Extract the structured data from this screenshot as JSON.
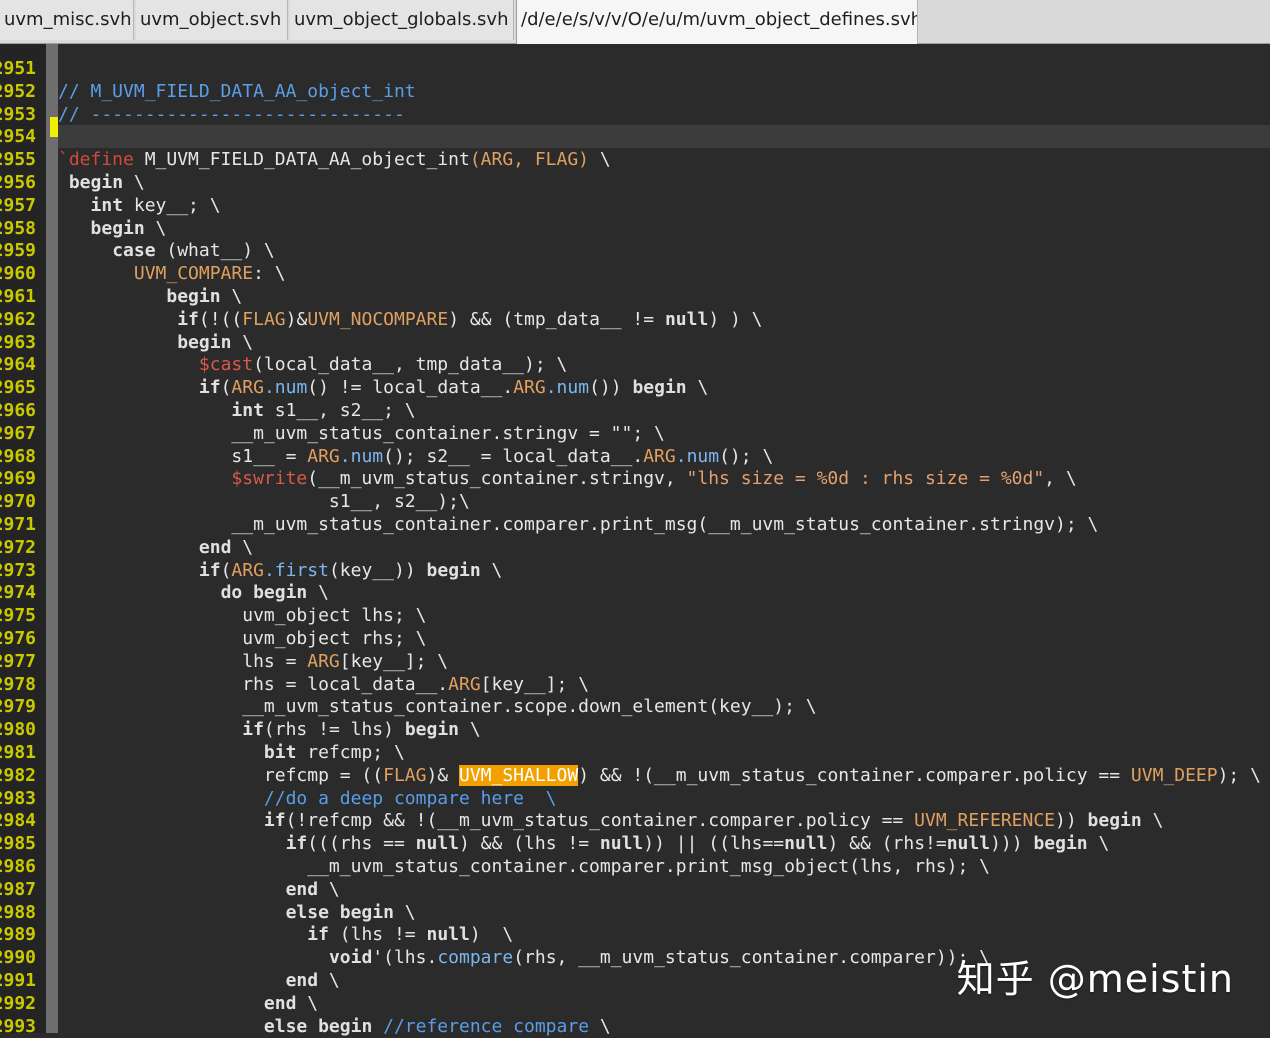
{
  "tabs": [
    {
      "label": "uvm_misc.svh",
      "active": false
    },
    {
      "label": "uvm_object.svh",
      "active": false
    },
    {
      "label": "uvm_object_globals.svh",
      "active": false
    },
    {
      "label": "/d/e/e/s/v/v/O/e/u/m/uvm_object_defines.svh",
      "active": true
    }
  ],
  "current_line": 2954,
  "lines": [
    {
      "n": "2951",
      "tokens": []
    },
    {
      "n": "2952",
      "tokens": [
        [
          "cm",
          "// M_UVM_FIELD_DATA_AA_object_int"
        ]
      ]
    },
    {
      "n": "2953",
      "tokens": [
        [
          "cm",
          "// -----------------------------"
        ]
      ]
    },
    {
      "n": "2954",
      "tokens": []
    },
    {
      "n": "2955",
      "tokens": [
        [
          "pp",
          "`define"
        ],
        [
          "nt",
          " M_UVM_FIELD_DATA_AA_object_int"
        ],
        [
          "mac",
          "(ARG, FLAG)"
        ],
        [
          "nt",
          " \\"
        ]
      ]
    },
    {
      "n": "2956",
      "tokens": [
        [
          "nt",
          " "
        ],
        [
          "kw",
          "begin"
        ],
        [
          "nt",
          " \\"
        ]
      ]
    },
    {
      "n": "2957",
      "tokens": [
        [
          "nt",
          "   "
        ],
        [
          "kw",
          "int"
        ],
        [
          "nt",
          " key__; \\"
        ]
      ]
    },
    {
      "n": "2958",
      "tokens": [
        [
          "nt",
          "   "
        ],
        [
          "kw",
          "begin"
        ],
        [
          "nt",
          " \\"
        ]
      ]
    },
    {
      "n": "2959",
      "tokens": [
        [
          "nt",
          "     "
        ],
        [
          "kw",
          "case"
        ],
        [
          "nt",
          " (what__) \\"
        ]
      ]
    },
    {
      "n": "2960",
      "tokens": [
        [
          "nt",
          "       "
        ],
        [
          "mac",
          "UVM_COMPARE"
        ],
        [
          "nt",
          ": \\"
        ]
      ]
    },
    {
      "n": "2961",
      "tokens": [
        [
          "nt",
          "          "
        ],
        [
          "kw",
          "begin"
        ],
        [
          "nt",
          " \\"
        ]
      ]
    },
    {
      "n": "2962",
      "tokens": [
        [
          "nt",
          "           "
        ],
        [
          "kw",
          "if"
        ],
        [
          "nt",
          "(!(("
        ],
        [
          "mac",
          "FLAG"
        ],
        [
          "nt",
          ")&"
        ],
        [
          "mac",
          "UVM_NOCOMPARE"
        ],
        [
          "nt",
          ") && (tmp_data__ != "
        ],
        [
          "kw",
          "null"
        ],
        [
          "nt",
          ") ) \\"
        ]
      ]
    },
    {
      "n": "2963",
      "tokens": [
        [
          "nt",
          "           "
        ],
        [
          "kw",
          "begin"
        ],
        [
          "nt",
          " \\"
        ]
      ]
    },
    {
      "n": "2964",
      "tokens": [
        [
          "nt",
          "             "
        ],
        [
          "sys",
          "$cast"
        ],
        [
          "nt",
          "(local_data__, tmp_data__); \\"
        ]
      ]
    },
    {
      "n": "2965",
      "tokens": [
        [
          "nt",
          "             "
        ],
        [
          "kw",
          "if"
        ],
        [
          "nt",
          "("
        ],
        [
          "mac",
          "ARG"
        ],
        [
          "fn",
          ".num"
        ],
        [
          "nt",
          "() != local_data__."
        ],
        [
          "mac",
          "ARG"
        ],
        [
          "fn",
          ".num"
        ],
        [
          "nt",
          "()) "
        ],
        [
          "kw",
          "begin"
        ],
        [
          "nt",
          " \\"
        ]
      ]
    },
    {
      "n": "2966",
      "tokens": [
        [
          "nt",
          "                "
        ],
        [
          "kw",
          "int"
        ],
        [
          "nt",
          " s1__, s2__; \\"
        ]
      ]
    },
    {
      "n": "2967",
      "tokens": [
        [
          "nt",
          "                __m_uvm_status_container.stringv = \"\"; \\"
        ]
      ]
    },
    {
      "n": "2968",
      "tokens": [
        [
          "nt",
          "                s1__ = "
        ],
        [
          "mac",
          "ARG"
        ],
        [
          "fn",
          ".num"
        ],
        [
          "nt",
          "(); s2__ = local_data__."
        ],
        [
          "mac",
          "ARG"
        ],
        [
          "fn",
          ".num"
        ],
        [
          "nt",
          "(); \\"
        ]
      ]
    },
    {
      "n": "2969",
      "tokens": [
        [
          "nt",
          "                "
        ],
        [
          "sys",
          "$swrite"
        ],
        [
          "nt",
          "(__m_uvm_status_container.stringv, "
        ],
        [
          "str",
          "\"lhs size = %0d : rhs size = %0d\""
        ],
        [
          "nt",
          ", \\"
        ]
      ]
    },
    {
      "n": "2970",
      "tokens": [
        [
          "nt",
          "                         s1__, s2__);\\"
        ]
      ]
    },
    {
      "n": "2971",
      "tokens": [
        [
          "nt",
          "                __m_uvm_status_container.comparer.print_msg(__m_uvm_status_container.stringv); \\"
        ]
      ]
    },
    {
      "n": "2972",
      "tokens": [
        [
          "nt",
          "             "
        ],
        [
          "kw",
          "end"
        ],
        [
          "nt",
          " \\"
        ]
      ]
    },
    {
      "n": "2973",
      "tokens": [
        [
          "nt",
          "             "
        ],
        [
          "kw",
          "if"
        ],
        [
          "nt",
          "("
        ],
        [
          "mac",
          "ARG"
        ],
        [
          "fn",
          ".first"
        ],
        [
          "nt",
          "(key__)) "
        ],
        [
          "kw",
          "begin"
        ],
        [
          "nt",
          " \\"
        ]
      ]
    },
    {
      "n": "2974",
      "tokens": [
        [
          "nt",
          "               "
        ],
        [
          "kw",
          "do begin"
        ],
        [
          "nt",
          " \\"
        ]
      ]
    },
    {
      "n": "2975",
      "tokens": [
        [
          "nt",
          "                 uvm_object lhs; \\"
        ]
      ]
    },
    {
      "n": "2976",
      "tokens": [
        [
          "nt",
          "                 uvm_object rhs; \\"
        ]
      ]
    },
    {
      "n": "2977",
      "tokens": [
        [
          "nt",
          "                 lhs = "
        ],
        [
          "mac",
          "ARG"
        ],
        [
          "nt",
          "[key__]; \\"
        ]
      ]
    },
    {
      "n": "2978",
      "tokens": [
        [
          "nt",
          "                 rhs = local_data__."
        ],
        [
          "mac",
          "ARG"
        ],
        [
          "nt",
          "[key__]; \\"
        ]
      ]
    },
    {
      "n": "2979",
      "tokens": [
        [
          "nt",
          "                 __m_uvm_status_container.scope.down_element(key__); \\"
        ]
      ]
    },
    {
      "n": "2980",
      "tokens": [
        [
          "nt",
          "                 "
        ],
        [
          "kw",
          "if"
        ],
        [
          "nt",
          "(rhs != lhs) "
        ],
        [
          "kw",
          "begin"
        ],
        [
          "nt",
          " \\"
        ]
      ]
    },
    {
      "n": "2981",
      "tokens": [
        [
          "nt",
          "                   "
        ],
        [
          "kw",
          "bit"
        ],
        [
          "nt",
          " refcmp; \\"
        ]
      ]
    },
    {
      "n": "2982",
      "tokens": [
        [
          "nt",
          "                   refcmp = (("
        ],
        [
          "mac",
          "FLAG"
        ],
        [
          "nt",
          ")& "
        ],
        [
          "hl",
          "UVM_SHALLOW"
        ],
        [
          "nt",
          ") && !(__m_uvm_status_container.comparer.policy == "
        ],
        [
          "mac",
          "UVM_DEEP"
        ],
        [
          "nt",
          "); \\"
        ]
      ]
    },
    {
      "n": "2983",
      "tokens": [
        [
          "nt",
          "                   "
        ],
        [
          "cm",
          "//do a deep compare here  \\"
        ]
      ]
    },
    {
      "n": "2984",
      "tokens": [
        [
          "nt",
          "                   "
        ],
        [
          "kw",
          "if"
        ],
        [
          "nt",
          "(!refcmp && !(__m_uvm_status_container.comparer.policy == "
        ],
        [
          "mac",
          "UVM_REFERENCE"
        ],
        [
          "nt",
          ")) "
        ],
        [
          "kw",
          "begin"
        ],
        [
          "nt",
          " \\"
        ]
      ]
    },
    {
      "n": "2985",
      "tokens": [
        [
          "nt",
          "                     "
        ],
        [
          "kw",
          "if"
        ],
        [
          "nt",
          "(((rhs == "
        ],
        [
          "kw",
          "null"
        ],
        [
          "nt",
          ") && (lhs != "
        ],
        [
          "kw",
          "null"
        ],
        [
          "nt",
          ")) || ((lhs=="
        ],
        [
          "kw",
          "null"
        ],
        [
          "nt",
          ") && (rhs!="
        ],
        [
          "kw",
          "null"
        ],
        [
          "nt",
          "))) "
        ],
        [
          "kw",
          "begin"
        ],
        [
          "nt",
          " \\"
        ]
      ]
    },
    {
      "n": "2986",
      "tokens": [
        [
          "nt",
          "                       __m_uvm_status_container.comparer.print_msg_object(lhs, rhs); \\"
        ]
      ]
    },
    {
      "n": "2987",
      "tokens": [
        [
          "nt",
          "                     "
        ],
        [
          "kw",
          "end"
        ],
        [
          "nt",
          " \\"
        ]
      ]
    },
    {
      "n": "2988",
      "tokens": [
        [
          "nt",
          "                     "
        ],
        [
          "kw",
          "else begin"
        ],
        [
          "nt",
          " \\"
        ]
      ]
    },
    {
      "n": "2989",
      "tokens": [
        [
          "nt",
          "                       "
        ],
        [
          "kw",
          "if"
        ],
        [
          "nt",
          " (lhs != "
        ],
        [
          "kw",
          "null"
        ],
        [
          "nt",
          ")  \\"
        ]
      ]
    },
    {
      "n": "2990",
      "tokens": [
        [
          "nt",
          "                         "
        ],
        [
          "kw",
          "void"
        ],
        [
          "nt",
          "'(lhs."
        ],
        [
          "fn",
          "compare"
        ],
        [
          "nt",
          "(rhs, __m_uvm_status_container.comparer)); \\"
        ]
      ]
    },
    {
      "n": "2991",
      "tokens": [
        [
          "nt",
          "                     "
        ],
        [
          "kw",
          "end"
        ],
        [
          "nt",
          " \\"
        ]
      ]
    },
    {
      "n": "2992",
      "tokens": [
        [
          "nt",
          "                   "
        ],
        [
          "kw",
          "end"
        ],
        [
          "nt",
          " \\"
        ]
      ]
    },
    {
      "n": "2993",
      "tokens": [
        [
          "nt",
          "                   "
        ],
        [
          "kw",
          "else begin"
        ],
        [
          "nt",
          " "
        ],
        [
          "cm",
          "//reference compare"
        ],
        [
          "nt",
          " \\"
        ]
      ]
    }
  ],
  "watermark": "知乎 @meistin"
}
